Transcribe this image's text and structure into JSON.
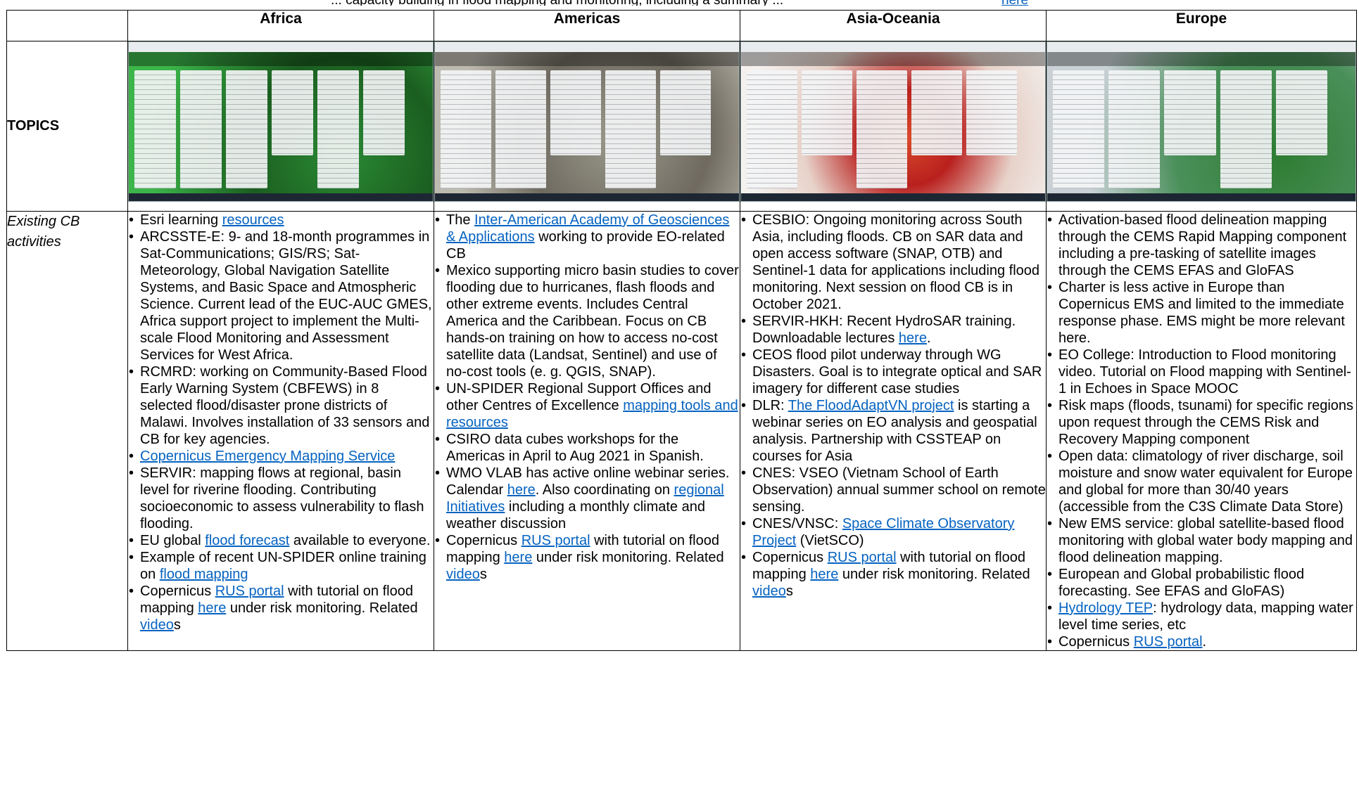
{
  "header_line": {
    "text": "... capacity building in flood mapping and monitoring, including a summary ...",
    "link": "here"
  },
  "columns": {
    "africa": "Africa",
    "americas": "Americas",
    "asia": "Asia-Oceania",
    "europe": "Europe"
  },
  "rows": {
    "topics": "TOPICS",
    "existing": "Existing CB activities"
  },
  "thumbnails": {
    "africa": "africa-board-screenshot",
    "americas": "americas-board-screenshot",
    "asia": "asia-board-screenshot",
    "europe": "europe-board-screenshot"
  },
  "africa": [
    {
      "parts": [
        {
          "t": "Esri learning "
        },
        {
          "t": "resources",
          "link": true
        }
      ]
    },
    {
      "parts": [
        {
          "t": "ARCSSTE-E:  9- and 18-month programmes in Sat-Communications; GIS/RS; Sat-Meteorology, Global Navigation Satellite Systems, and Basic Space and Atmospheric Science. Current lead of the EUC-AUC GMES, Africa support project to implement the Multi-scale Flood Monitoring and Assessment Services for West Africa."
        }
      ]
    },
    {
      "parts": [
        {
          "t": "RCMRD: working on Community-Based Flood Early Warning System (CBFEWS) in 8 selected flood/disaster prone districts of Malawi. Involves installation of 33 sensors and CB for key agencies."
        }
      ]
    },
    {
      "parts": [
        {
          "t": "Copernicus Emergency Mapping Service",
          "link": true
        }
      ]
    },
    {
      "parts": [
        {
          "t": "SERVIR: mapping flows at regional, basin level for riverine flooding. Contributing socioeconomic to assess vulnerability to flash flooding."
        }
      ]
    },
    {
      "parts": [
        {
          "t": "EU global "
        },
        {
          "t": "flood forecast",
          "link": true
        },
        {
          "t": " available to everyone."
        }
      ]
    },
    {
      "parts": [
        {
          "t": "Example of recent UN-SPIDER online training on "
        },
        {
          "t": "flood mapping",
          "link": true
        }
      ]
    },
    {
      "parts": [
        {
          "t": "Copernicus "
        },
        {
          "t": "RUS portal",
          "link": true
        },
        {
          "t": " with tutorial on flood mapping "
        },
        {
          "t": "here",
          "link": true
        },
        {
          "t": " under risk monitoring. Related "
        },
        {
          "t": "video",
          "link": true
        },
        {
          "t": "s"
        }
      ]
    }
  ],
  "americas": [
    {
      "parts": [
        {
          "t": "The "
        },
        {
          "t": "Inter-American Academy of Geosciences & Applications",
          "link": true
        },
        {
          "t": " working to provide EO-related CB"
        }
      ]
    },
    {
      "parts": [
        {
          "t": "Mexico supporting micro basin studies to cover flooding due to hurricanes, flash floods and other extreme events. Includes Central America and the Caribbean. Focus on CB hands-on training on how to access no-cost satellite data (Landsat, Sentinel) and use of no-cost tools (e. g. QGIS, SNAP)."
        }
      ]
    },
    {
      "parts": [
        {
          "t": "UN-SPIDER Regional Support Offices and other Centres of Excellence "
        },
        {
          "t": "mapping tools and resources",
          "link": true
        }
      ]
    },
    {
      "parts": [
        {
          "t": "CSIRO data cubes workshops for the Americas in April to Aug 2021 in Spanish."
        }
      ]
    },
    {
      "parts": [
        {
          "t": "WMO VLAB has active online webinar series. Calendar "
        },
        {
          "t": "here",
          "link": true
        },
        {
          "t": ". Also coordinating on "
        },
        {
          "t": "regional Initiatives",
          "link": true
        },
        {
          "t": " including a monthly climate and weather discussion"
        }
      ]
    },
    {
      "parts": [
        {
          "t": "Copernicus "
        },
        {
          "t": "RUS portal",
          "link": true
        },
        {
          "t": " with tutorial on flood mapping "
        },
        {
          "t": "here",
          "link": true
        },
        {
          "t": " under risk monitoring. Related "
        },
        {
          "t": "video",
          "link": true
        },
        {
          "t": "s"
        }
      ]
    }
  ],
  "asia": [
    {
      "parts": [
        {
          "t": "CESBIO: Ongoing monitoring across South Asia, including floods. CB on SAR data and open access software (SNAP, OTB) and Sentinel-1 data for applications including flood monitoring. Next session on flood CB is in October 2021."
        }
      ]
    },
    {
      "parts": [
        {
          "t": "SERVIR-HKH: Recent HydroSAR training. Downloadable lectures "
        },
        {
          "t": "here",
          "link": true
        },
        {
          "t": "."
        }
      ]
    },
    {
      "parts": [
        {
          "t": "CEOS flood pilot underway through WG Disasters. Goal is to integrate optical and SAR imagery for different case studies"
        }
      ]
    },
    {
      "parts": [
        {
          "t": "DLR: "
        },
        {
          "t": "The FloodAdaptVN project",
          "link": true
        },
        {
          "t": " is starting a webinar series on EO analysis and geospatial analysis. Partnership with CSSTEAP on courses for Asia"
        }
      ]
    },
    {
      "parts": [
        {
          "t": "CNES: VSEO (Vietnam School of Earth Observation) annual summer school on remote sensing."
        }
      ]
    },
    {
      "parts": [
        {
          "t": "CNES/VNSC: "
        },
        {
          "t": "Space Climate Observatory Project",
          "link": true
        },
        {
          "t": " (VietSCO)"
        }
      ]
    },
    {
      "parts": [
        {
          "t": "Copernicus "
        },
        {
          "t": "RUS portal",
          "link": true
        },
        {
          "t": " with tutorial on flood mapping "
        },
        {
          "t": "here",
          "link": true
        },
        {
          "t": " under risk monitoring. Related "
        },
        {
          "t": "video",
          "link": true
        },
        {
          "t": "s"
        }
      ]
    }
  ],
  "europe": [
    {
      "parts": [
        {
          "t": "Activation-based flood delineation mapping through the CEMS Rapid Mapping component including a pre-tasking of satellite images through the CEMS EFAS and GloFAS"
        }
      ]
    },
    {
      "parts": [
        {
          "t": "Charter is less active in Europe than Copernicus EMS and limited to the immediate response phase. EMS might be more relevant here."
        }
      ]
    },
    {
      "parts": [
        {
          "t": "EO College: Introduction to Flood monitoring video. Tutorial on Flood mapping with Sentinel-1 in Echoes in Space MOOC"
        }
      ]
    },
    {
      "parts": [
        {
          "t": "Risk maps (floods, tsunami) for specific regions upon request through the CEMS Risk and Recovery Mapping component"
        }
      ]
    },
    {
      "parts": [
        {
          "t": "Open data: climatology of river discharge, soil moisture and snow water equivalent for Europe and global for more than 30/40 years (accessible from the C3S Climate Data Store)"
        }
      ]
    },
    {
      "parts": [
        {
          "t": "New EMS service: global satellite-based flood monitoring with global water body mapping and flood delineation mapping."
        }
      ]
    },
    {
      "parts": [
        {
          "t": "European and Global probabilistic flood forecasting. See EFAS and GloFAS)"
        }
      ]
    },
    {
      "parts": [
        {
          "t": "Hydrology TEP",
          "link": true
        },
        {
          "t": ": hydrology data, mapping water level time series, etc"
        }
      ]
    },
    {
      "parts": [
        {
          "t": "Copernicus "
        },
        {
          "t": "RUS portal",
          "link": true
        },
        {
          "t": "."
        }
      ]
    }
  ]
}
